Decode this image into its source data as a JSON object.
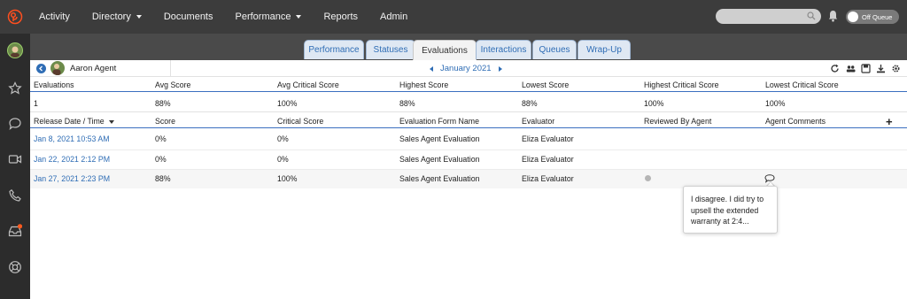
{
  "colors": {
    "topbar": "#3c3c3c",
    "sidebar": "#2c2c2c",
    "accent": "#2f6db5",
    "logo": "#ff4f1f"
  },
  "topnav": {
    "items": [
      {
        "label": "Activity"
      },
      {
        "label": "Directory",
        "has_dropdown": true
      },
      {
        "label": "Documents"
      },
      {
        "label": "Performance",
        "has_dropdown": true
      },
      {
        "label": "Reports"
      },
      {
        "label": "Admin"
      }
    ],
    "search_placeholder": "",
    "status_toggle_label": "Off Queue"
  },
  "sidebar": {
    "icons": [
      "user-avatar",
      "star-icon",
      "chat-icon",
      "video-icon",
      "phone-icon",
      "inbox-icon",
      "help-icon"
    ]
  },
  "tabs": [
    {
      "label": "Performance",
      "active": false
    },
    {
      "label": "Statuses",
      "active": false
    },
    {
      "label": "Evaluations",
      "active": true
    },
    {
      "label": "Interactions",
      "active": false
    },
    {
      "label": "Queues",
      "active": false
    },
    {
      "label": "Wrap-Up",
      "active": false
    }
  ],
  "subbar": {
    "agent_name": "Aaron Agent",
    "month": "January 2021"
  },
  "summary": {
    "headers": [
      "Evaluations",
      "Avg Score",
      "Avg Critical Score",
      "Highest Score",
      "Lowest Score",
      "Highest Critical Score",
      "Lowest Critical Score"
    ],
    "values": [
      "1",
      "88%",
      "100%",
      "88%",
      "88%",
      "100%",
      "100%"
    ]
  },
  "details": {
    "headers": [
      "Release Date / Time",
      "Score",
      "Critical Score",
      "Evaluation Form Name",
      "Evaluator",
      "Reviewed By Agent",
      "Agent Comments"
    ],
    "rows": [
      [
        "Jan 8, 2021 10:53 AM",
        "0%",
        "0%",
        "Sales Agent Evaluation",
        "Eliza Evaluator"
      ],
      [
        "Jan 22, 2021 2:12 PM",
        "0%",
        "0%",
        "Sales Agent Evaluation",
        "Eliza Evaluator"
      ],
      [
        "Jan 27, 2021 2:23 PM",
        "88%",
        "100%",
        "Sales Agent Evaluation",
        "Eliza Evaluator"
      ]
    ],
    "add_column_label": "+"
  },
  "tooltip": {
    "text": "I disagree. I did try to upsell the extended warranty at 2:4..."
  }
}
